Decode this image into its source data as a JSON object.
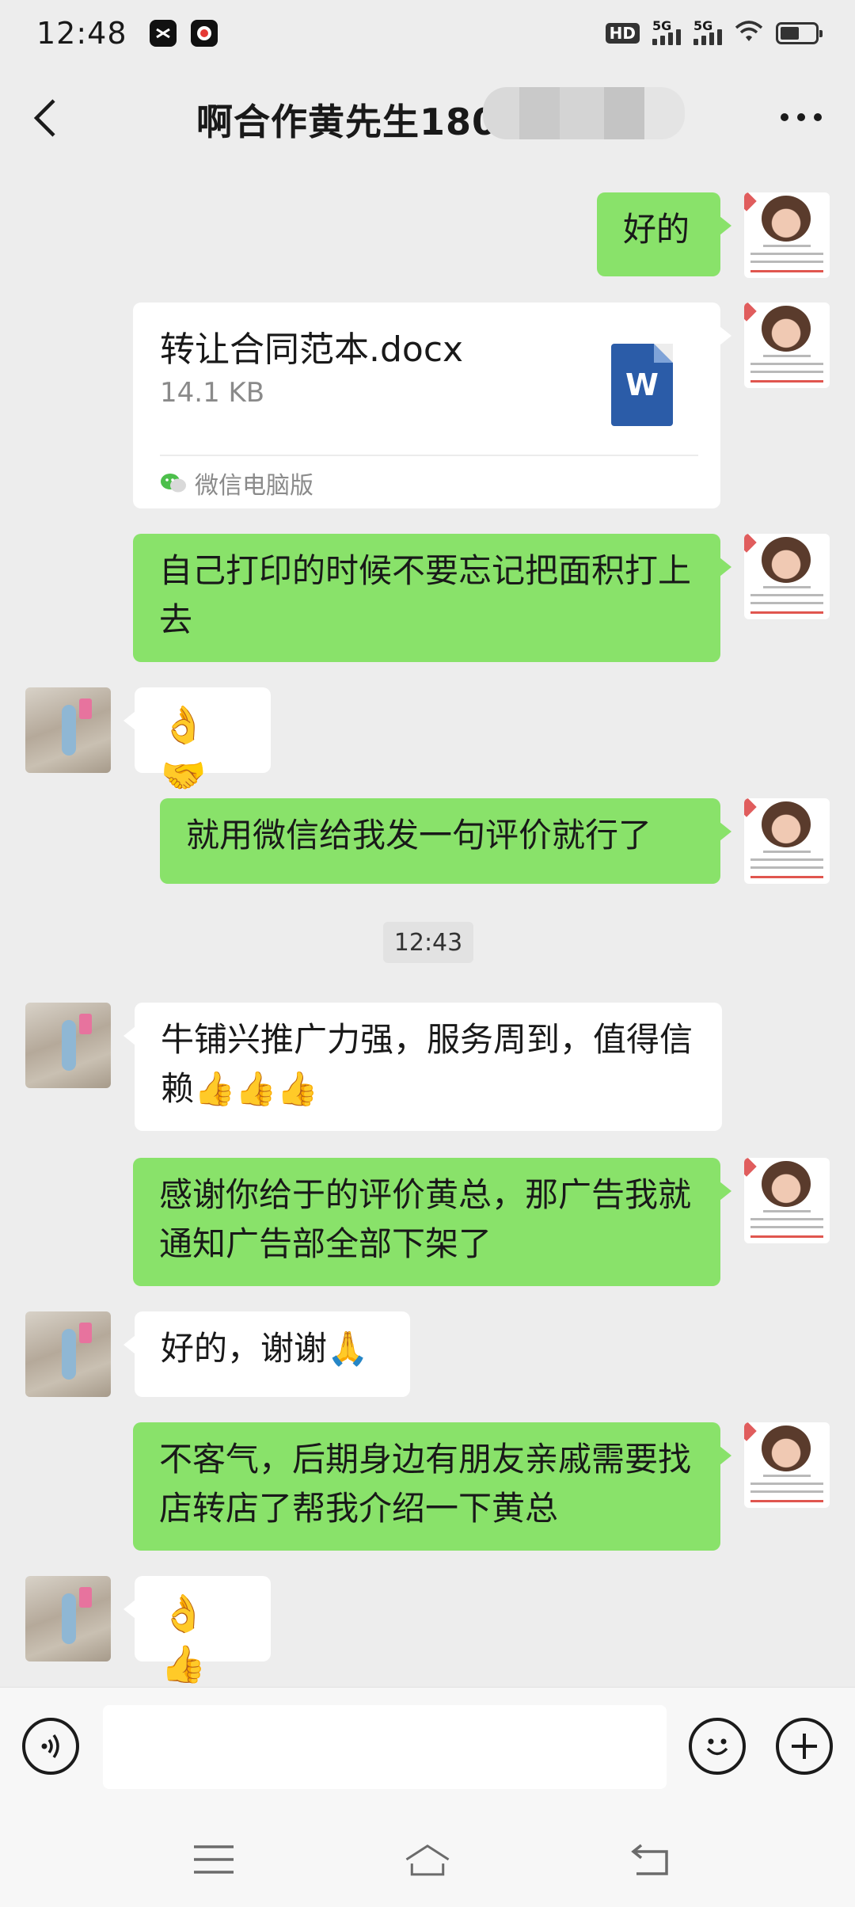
{
  "status_bar": {
    "time": "12:48",
    "hd_label": "HD",
    "signal1_label": "5G",
    "signal2_label": "5G",
    "battery_level": 0.55,
    "icons": [
      "capcut-icon",
      "record-icon",
      "wifi-icon",
      "battery-icon"
    ]
  },
  "header": {
    "title": "啊合作黄先生1806",
    "back_icon": "chevron-left-icon",
    "more_icon": "more-dots-icon"
  },
  "messages": [
    {
      "side": "me",
      "type": "text",
      "text": "好的"
    },
    {
      "side": "me",
      "type": "file",
      "file_name": "转让合同范本.docx",
      "file_size": "14.1  KB",
      "file_icon": "W",
      "source": "微信电脑版"
    },
    {
      "side": "me",
      "type": "text",
      "text": "自己打印的时候不要忘记把面积打上去"
    },
    {
      "side": "them",
      "type": "emoji",
      "text": "👌🤝"
    },
    {
      "side": "me",
      "type": "text",
      "text": "就用微信给我发一句评价就行了"
    },
    {
      "side": "system",
      "type": "timestamp",
      "text": "12:43"
    },
    {
      "side": "them",
      "type": "text",
      "text": " 牛铺兴推广力强，服务周到，值得信赖👍👍👍"
    },
    {
      "side": "me",
      "type": "text",
      "text": "感谢你给于的评价黄总，那广告我就通知广告部全部下架了"
    },
    {
      "side": "them",
      "type": "text",
      "text": "好的，谢谢🙏"
    },
    {
      "side": "me",
      "type": "text",
      "text": "不客气，后期身边有朋友亲戚需要找店转店了帮我介绍一下黄总"
    },
    {
      "side": "them",
      "type": "emoji",
      "text": "👌👍"
    }
  ],
  "input_bar": {
    "voice_icon": "voice-icon",
    "emoji_icon": "emoji-icon",
    "plus_icon": "plus-icon",
    "text_value": ""
  },
  "system_nav": {
    "icons": [
      "menu-icon",
      "home-icon",
      "back-icon"
    ]
  },
  "colors": {
    "background": "#ededed",
    "my_bubble": "#89e26a",
    "their_bubble": "#ffffff",
    "word_blue": "#2b5ca8"
  }
}
